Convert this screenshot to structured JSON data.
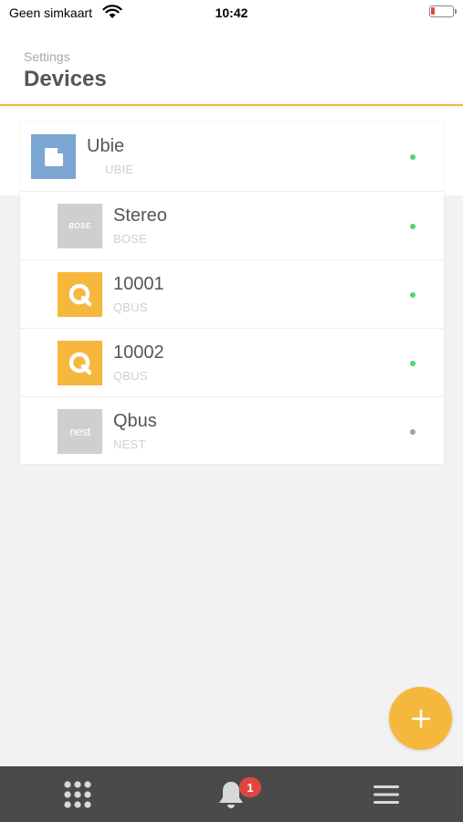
{
  "status_bar": {
    "carrier": "Geen simkaart",
    "time": "10:42",
    "battery_level": 0.1
  },
  "header": {
    "breadcrumb": "Settings",
    "title": "Devices"
  },
  "devices": [
    {
      "name": "Ubie",
      "brand": "UBIE",
      "icon": "ubie-icon",
      "tile_color": "#7ba6d1",
      "status_color": "#4cd964",
      "level": 0
    },
    {
      "name": "Stereo",
      "brand": "BOSE",
      "icon": "bose-logo-icon",
      "tile_color": "#cfcfcf",
      "status_color": "#4cd964",
      "level": 1
    },
    {
      "name": "10001",
      "brand": "QBUS",
      "icon": "qbus-logo-icon",
      "tile_color": "#f5b83d",
      "status_color": "#4cd964",
      "level": 1
    },
    {
      "name": "10002",
      "brand": "QBUS",
      "icon": "qbus-logo-icon",
      "tile_color": "#f5b83d",
      "status_color": "#4cd964",
      "level": 1
    },
    {
      "name": "Qbus",
      "brand": "NEST",
      "icon": "nest-logo-icon",
      "tile_color": "#cfcfcf",
      "status_color": "#a0a0a0",
      "level": 1
    }
  ],
  "fab": {
    "icon": "plus-icon",
    "color": "#f5b83d"
  },
  "tabbar": {
    "tabs": [
      {
        "icon": "grid-icon"
      },
      {
        "icon": "bell-icon",
        "badge": "1"
      },
      {
        "icon": "hamburger-menu-icon"
      }
    ]
  },
  "colors": {
    "accent": "#f0b64a",
    "online": "#4cd964",
    "offline": "#a0a0a0",
    "badge": "#e0463d",
    "tabbar": "#4a4a4a"
  }
}
